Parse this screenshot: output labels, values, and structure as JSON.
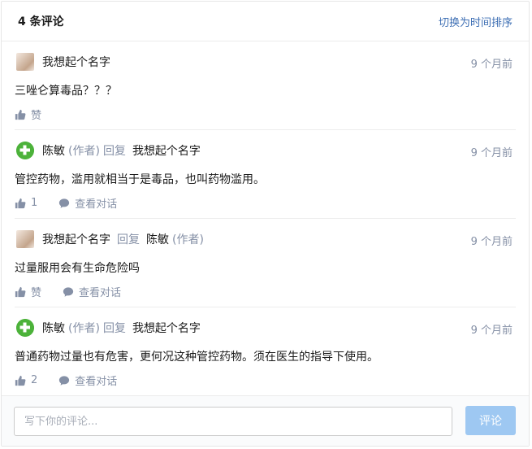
{
  "header": {
    "count_label": "4 条评论",
    "sort_label": "切换为时间排序"
  },
  "comments": [
    {
      "avatar": "user-photo",
      "author": "我想起个名字",
      "author_tag": "",
      "reply_word": "",
      "reply_to": "",
      "reply_to_tag": "",
      "time": "9 个月前",
      "content": "三唑仑算毒品？？？",
      "like_label": "赞",
      "has_conversation": false
    },
    {
      "avatar": "doctor-logo",
      "author": "陈敏",
      "author_tag": "(作者)",
      "reply_word": "回复",
      "reply_to": "我想起个名字",
      "reply_to_tag": "",
      "time": "9 个月前",
      "content": "管控药物，滥用就相当于是毒品，也叫药物滥用。",
      "like_label": "1",
      "conversation_label": "查看对话",
      "has_conversation": true
    },
    {
      "avatar": "user-photo",
      "author": "我想起个名字",
      "author_tag": "",
      "reply_word": "回复",
      "reply_to": "陈敏",
      "reply_to_tag": "(作者)",
      "time": "9 个月前",
      "content": "过量服用会有生命危险吗",
      "like_label": "赞",
      "conversation_label": "查看对话",
      "has_conversation": true
    },
    {
      "avatar": "doctor-logo",
      "author": "陈敏",
      "author_tag": "(作者)",
      "reply_word": "回复",
      "reply_to": "我想起个名字",
      "reply_to_tag": "",
      "time": "9 个月前",
      "content": "普通药物过量也有危害，更何况这种管控药物。须在医生的指导下使用。",
      "like_label": "2",
      "conversation_label": "查看对话",
      "has_conversation": true
    }
  ],
  "footer": {
    "input_placeholder": "写下你的评论...",
    "submit_label": "评论"
  },
  "colors": {
    "link": "#3e6fb4",
    "muted": "#8590a6",
    "submit_bg": "#9ec8f2",
    "logo_green": "#4cb23a"
  }
}
